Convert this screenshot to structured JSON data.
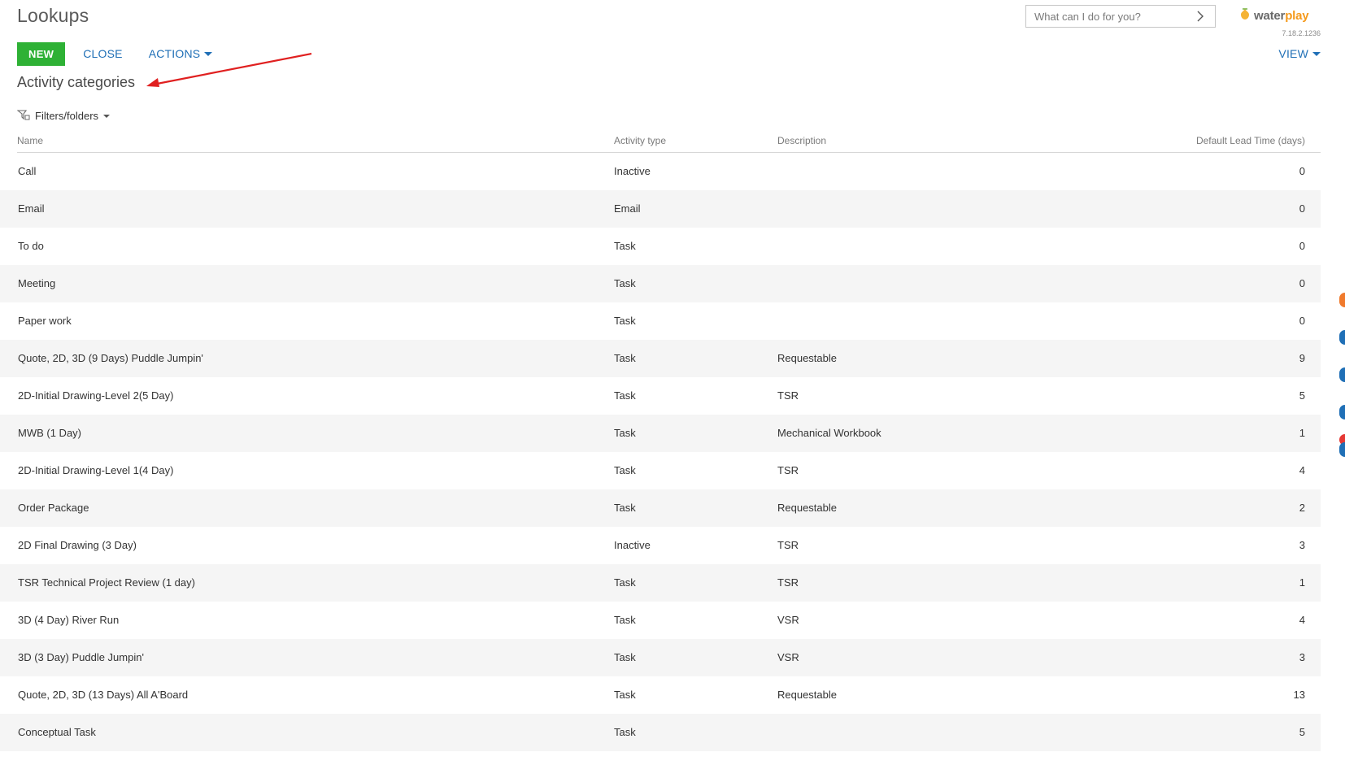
{
  "header": {
    "title": "Lookups",
    "search_placeholder": "What can I do for you?",
    "logo_text_1": "water",
    "logo_text_2": "play",
    "version": "7.18.2.1236"
  },
  "toolbar": {
    "new_label": "NEW",
    "close_label": "CLOSE",
    "actions_label": "ACTIONS",
    "view_label": "VIEW"
  },
  "section": {
    "title": "Activity categories",
    "filters_label": "Filters/folders"
  },
  "grid": {
    "columns": {
      "name": "Name",
      "activity_type": "Activity type",
      "description": "Description",
      "lead_time": "Default Lead Time (days)"
    },
    "rows": [
      {
        "name": "Call",
        "type": "Inactive",
        "desc": "",
        "lead": "0"
      },
      {
        "name": "Email",
        "type": "Email",
        "desc": "",
        "lead": "0"
      },
      {
        "name": "To do",
        "type": "Task",
        "desc": "",
        "lead": "0"
      },
      {
        "name": "Meeting",
        "type": "Task",
        "desc": "",
        "lead": "0"
      },
      {
        "name": "Paper work",
        "type": "Task",
        "desc": "",
        "lead": "0"
      },
      {
        "name": "Quote, 2D, 3D (9 Days) Puddle Jumpin'",
        "type": "Task",
        "desc": "Requestable",
        "lead": "9"
      },
      {
        "name": "2D-Initial Drawing-Level 2(5 Day)",
        "type": "Task",
        "desc": "TSR",
        "lead": "5"
      },
      {
        "name": "MWB (1 Day)",
        "type": "Task",
        "desc": "Mechanical Workbook",
        "lead": "1"
      },
      {
        "name": "2D-Initial Drawing-Level 1(4 Day)",
        "type": "Task",
        "desc": "TSR",
        "lead": "4"
      },
      {
        "name": "Order Package",
        "type": "Task",
        "desc": "Requestable",
        "lead": "2"
      },
      {
        "name": "2D Final Drawing (3 Day)",
        "type": "Inactive",
        "desc": "TSR",
        "lead": "3"
      },
      {
        "name": "TSR Technical Project Review (1 day)",
        "type": "Task",
        "desc": "TSR",
        "lead": "1"
      },
      {
        "name": "3D (4 Day) River Run",
        "type": "Task",
        "desc": "VSR",
        "lead": "4"
      },
      {
        "name": "3D (3 Day) Puddle Jumpin'",
        "type": "Task",
        "desc": "VSR",
        "lead": "3"
      },
      {
        "name": "Quote, 2D, 3D (13 Days) All A'Board",
        "type": "Task",
        "desc": "Requestable",
        "lead": "13"
      },
      {
        "name": "Conceptual Task",
        "type": "Task",
        "desc": "",
        "lead": "5"
      }
    ]
  },
  "colors": {
    "new_button": "#2eb135",
    "link": "#1f6fb6",
    "annotation_arrow": "#e02020",
    "logo_accent": "#f59a1c"
  }
}
